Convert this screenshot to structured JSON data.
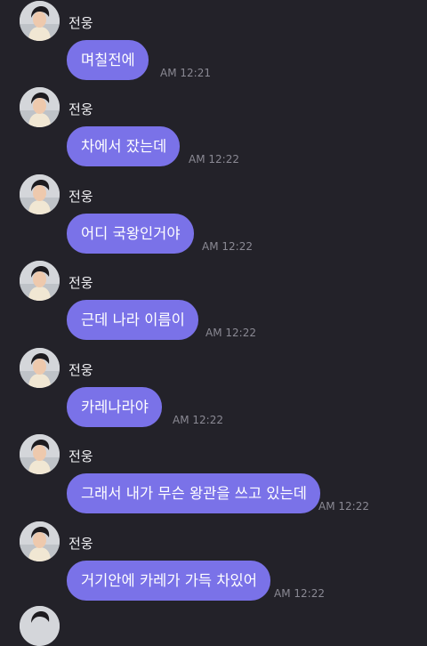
{
  "messages": [
    {
      "sender": "전웅",
      "text": "며칠전에",
      "time": "AM 12:21"
    },
    {
      "sender": "전웅",
      "text": "차에서 잤는데",
      "time": "AM 12:22"
    },
    {
      "sender": "전웅",
      "text": "어디 국왕인거야",
      "time": "AM 12:22"
    },
    {
      "sender": "전웅",
      "text": "근데 나라 이름이",
      "time": "AM 12:22"
    },
    {
      "sender": "전웅",
      "text": "카레나라야",
      "time": "AM 12:22"
    },
    {
      "sender": "전웅",
      "text": "그래서 내가 무슨 왕관을 쓰고 있는데",
      "time": "AM 12:22"
    },
    {
      "sender": "전웅",
      "text": "거기안에 카레가 가득 차있어",
      "time": "AM 12:22"
    }
  ],
  "colors": {
    "background": "#232229",
    "bubble": "#7a72e8",
    "bubble_text": "#ffffff",
    "sender_text": "#f1f1f4",
    "time_text": "#8a8993"
  }
}
